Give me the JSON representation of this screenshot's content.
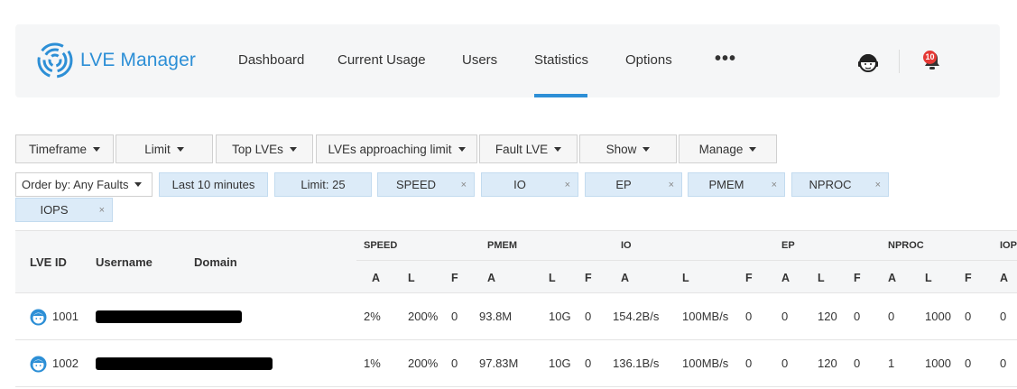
{
  "nav": {
    "brand": "LVE Manager",
    "items": [
      "Dashboard",
      "Current Usage",
      "Users",
      "Statistics",
      "Options"
    ],
    "active": "Statistics",
    "more": "•••",
    "notifications_count": "10",
    "accent": "#2d8fd6",
    "icons": [
      "lve-logo-icon",
      "support-agent-icon",
      "bell-icon"
    ]
  },
  "filters": {
    "timeframe": "Timeframe",
    "limit": "Limit",
    "top_lves": "Top LVEs",
    "approaching": "LVEs approaching limit",
    "fault_lve": "Fault LVE",
    "show": "Show",
    "manage": "Manage"
  },
  "chips": {
    "order_by": "Order by: Any Faults",
    "last": "Last 10 minutes",
    "limit": "Limit: 25",
    "tags": [
      "SPEED",
      "IO",
      "EP",
      "PMEM",
      "NPROC",
      "IOPS"
    ],
    "remove": "×"
  },
  "table": {
    "columns": {
      "lve_id": "LVE ID",
      "username": "Username",
      "domain": "Domain"
    },
    "groups": [
      "SPEED",
      "PMEM",
      "IO",
      "EP",
      "NPROC",
      "IOP"
    ],
    "subheaders": [
      "A",
      "L",
      "F",
      "A",
      "L",
      "F",
      "A",
      "L",
      "F",
      "A",
      "L",
      "F",
      "A",
      "L",
      "F",
      "A"
    ],
    "rows": [
      {
        "id": "1001",
        "values": [
          "2%",
          "200%",
          "0",
          "93.8M",
          "10G",
          "0",
          "154.2B/s",
          "100MB/s",
          "0",
          "0",
          "120",
          "0",
          "0",
          "1000",
          "0",
          "0"
        ]
      },
      {
        "id": "1002",
        "values": [
          "1%",
          "200%",
          "0",
          "97.83M",
          "10G",
          "0",
          "136.1B/s",
          "100MB/s",
          "0",
          "0",
          "120",
          "0",
          "1",
          "1000",
          "0",
          "0"
        ]
      }
    ]
  }
}
